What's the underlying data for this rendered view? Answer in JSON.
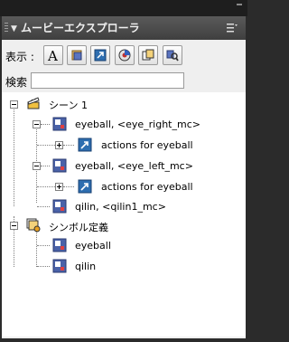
{
  "header": {
    "title": "ムービーエクスプローラ"
  },
  "toolbar": {
    "show_label": "表示 :",
    "search_label": "検索 :",
    "search_value": ""
  },
  "tree": {
    "scene": "シーン 1",
    "eyeball_right": "eyeball, <eye_right_mc>",
    "actions_1": "actions for eyeball",
    "eyeball_left": "eyeball, <eye_left_mc>",
    "actions_2": "actions for eyeball",
    "qilin_instance": "qilin, <qilin1_mc>",
    "symbol_defs": "シンボル定義",
    "sym_eyeball": "eyeball",
    "sym_qilin": "qilin"
  }
}
